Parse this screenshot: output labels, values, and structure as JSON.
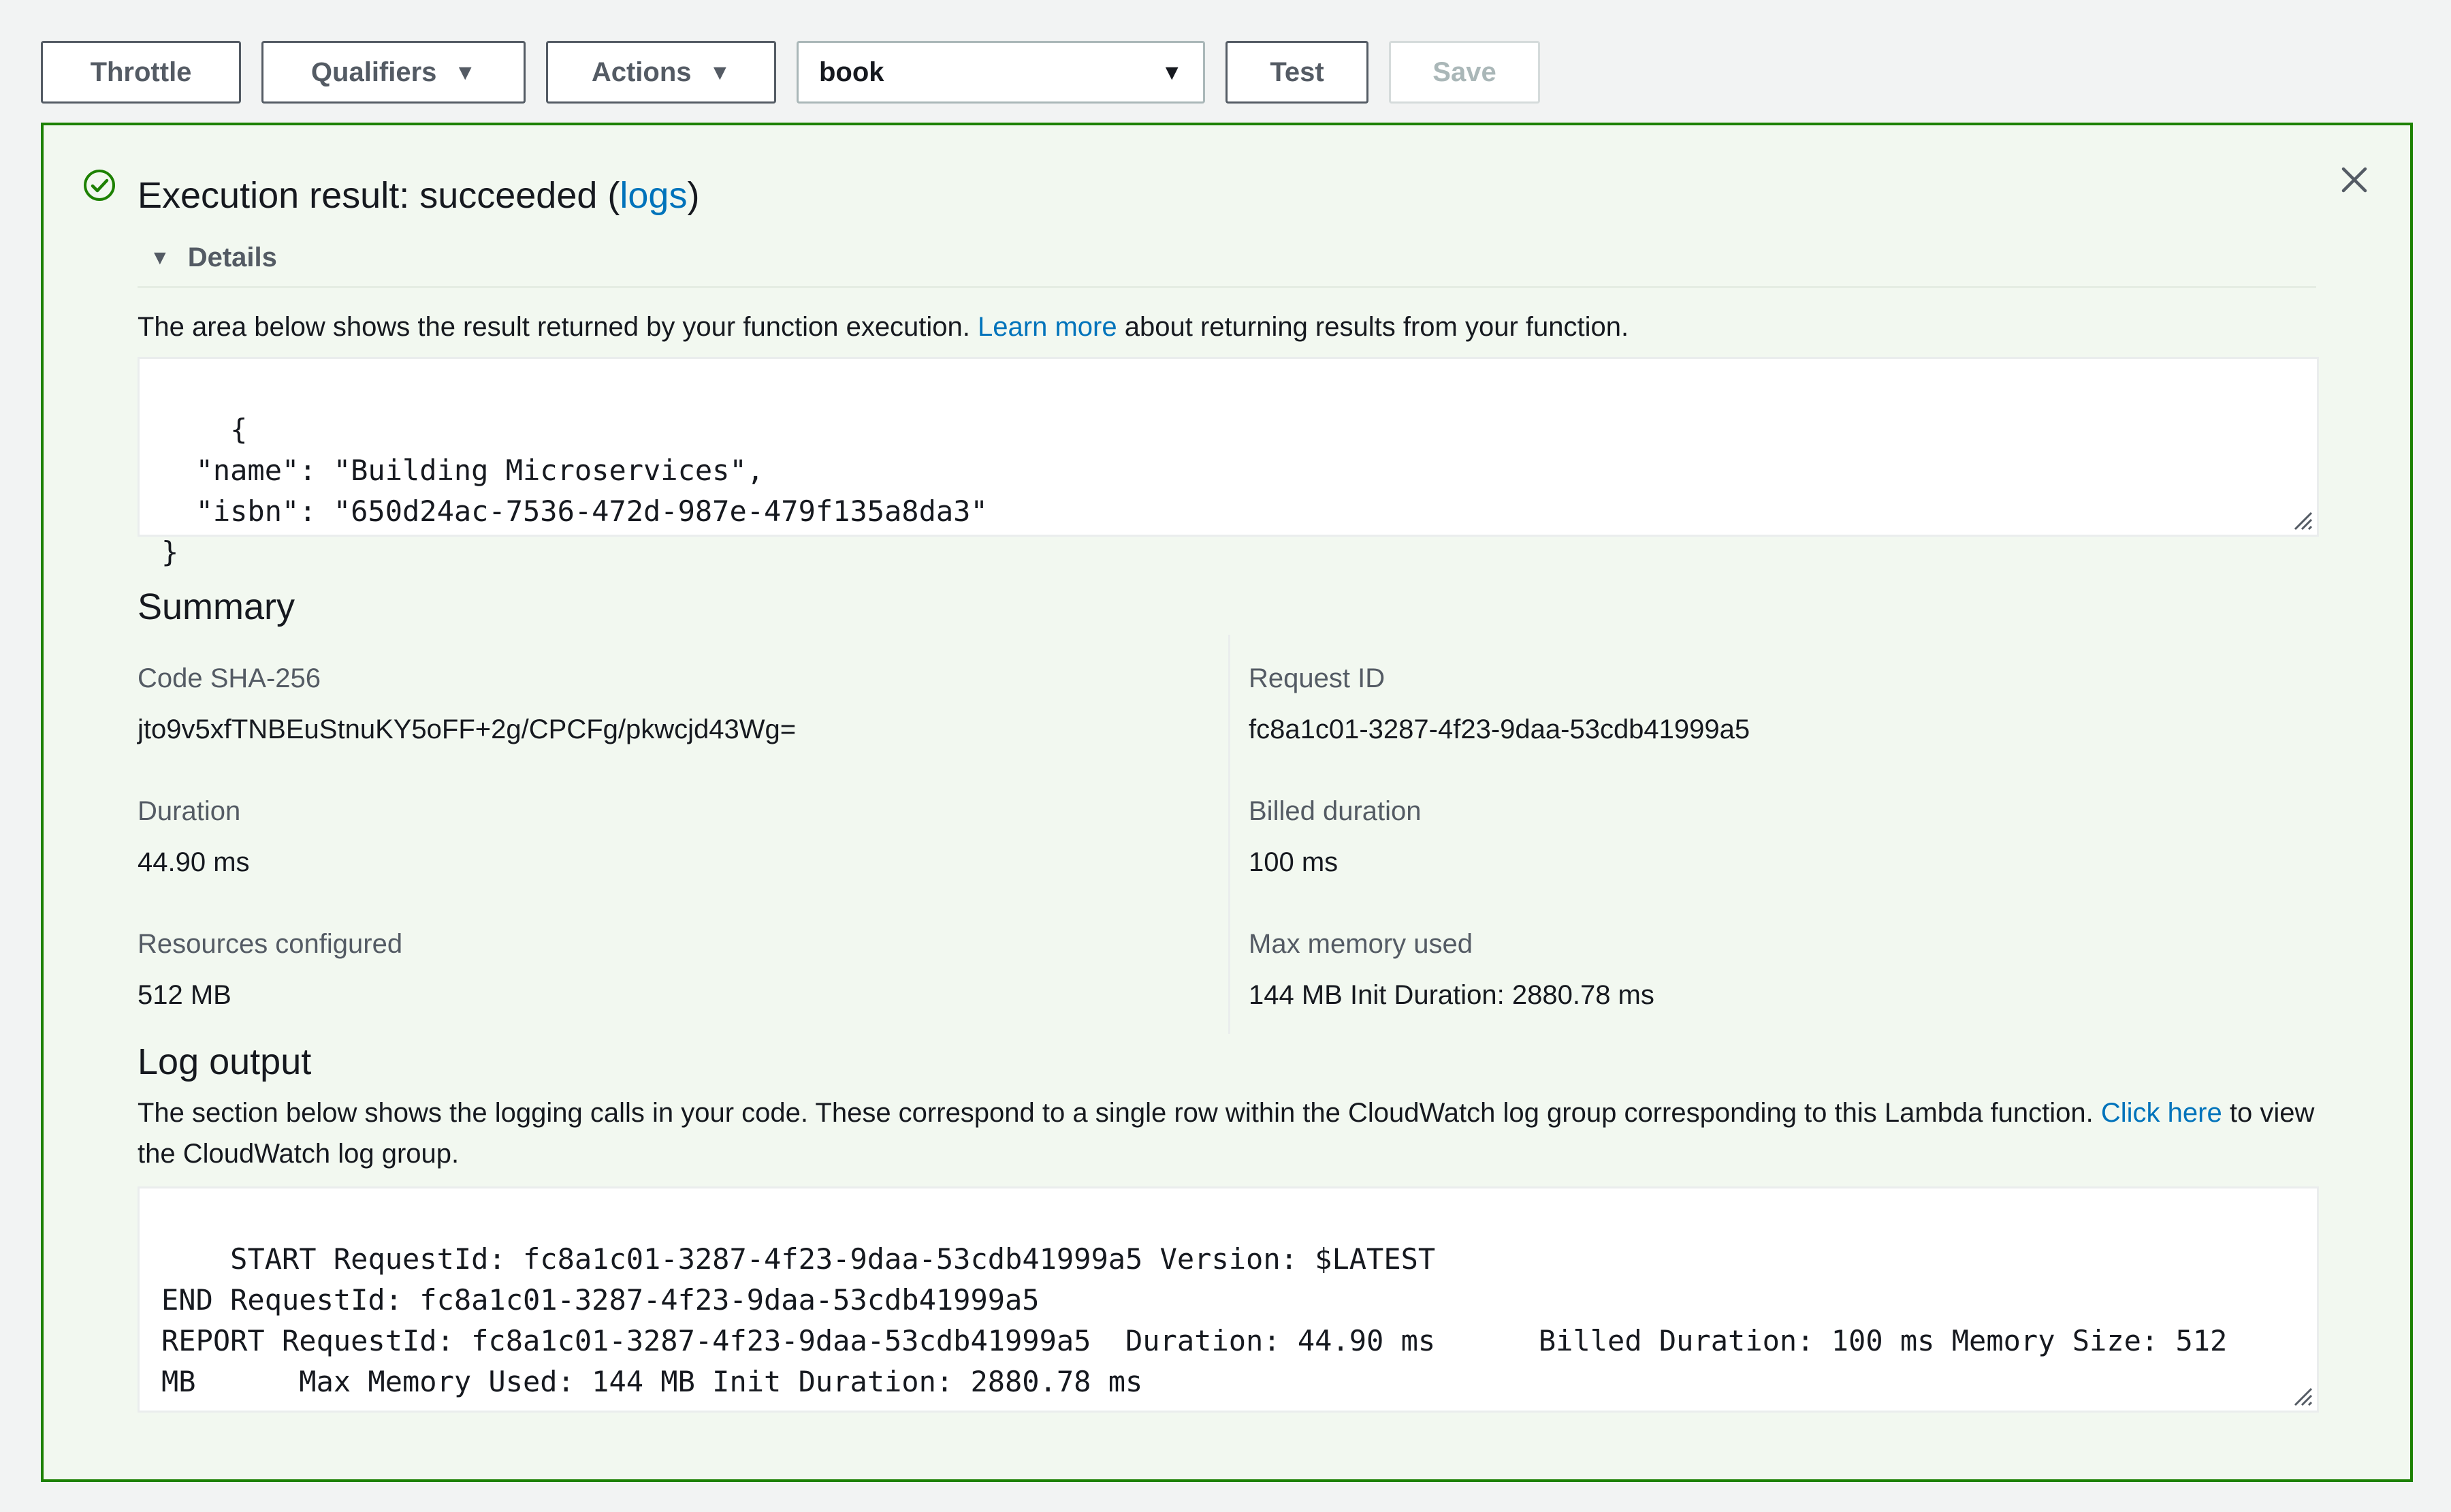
{
  "toolbar": {
    "throttle": "Throttle",
    "qualifiers": "Qualifiers",
    "actions": "Actions",
    "test_event": "book",
    "test": "Test",
    "save": "Save"
  },
  "result": {
    "prefix": "Execution result: succeeded (",
    "logs_link": "logs",
    "suffix": ")",
    "details_label": "Details",
    "desc_prefix": "The area below shows the result returned by your function execution.",
    "learn_more": "Learn more",
    "desc_suffix": "about returning results from your function.",
    "code": "{\n  \"name\": \"Building Microservices\",\n  \"isbn\": \"650d24ac-7536-472d-987e-479f135a8da3\"\n}"
  },
  "summary": {
    "title": "Summary",
    "code_sha_label": "Code SHA-256",
    "code_sha": "jto9v5xfTNBEuStnuKY5oFF+2g/CPCFg/pkwcjd43Wg=",
    "request_id_label": "Request ID",
    "request_id": "fc8a1c01-3287-4f23-9daa-53cdb41999a5",
    "duration_label": "Duration",
    "duration": "44.90 ms",
    "billed_label": "Billed duration",
    "billed": "100 ms",
    "resources_label": "Resources configured",
    "resources": "512 MB",
    "max_mem_label": "Max memory used",
    "max_mem": "144 MB Init Duration: 2880.78 ms"
  },
  "log": {
    "title": "Log output",
    "desc_prefix": "The section below shows the logging calls in your code. These correspond to a single row within the CloudWatch log group corresponding to this Lambda function.",
    "click_here": "Click here",
    "desc_suffix": "to view the CloudWatch log group.",
    "output": "START RequestId: fc8a1c01-3287-4f23-9daa-53cdb41999a5 Version: $LATEST\nEND RequestId: fc8a1c01-3287-4f23-9daa-53cdb41999a5\nREPORT RequestId: fc8a1c01-3287-4f23-9daa-53cdb41999a5  Duration: 44.90 ms      Billed Duration: 100 ms Memory Size: 512\nMB      Max Memory Used: 144 MB Init Duration: 2880.78 ms"
  },
  "colors": {
    "success_green": "#1d8102",
    "link_blue": "#0073bb",
    "panel_bg": "#f2f8f0"
  },
  "icons": [
    "check-circle-icon",
    "close-icon",
    "caret-down-icon",
    "resize-grip-icon"
  ]
}
